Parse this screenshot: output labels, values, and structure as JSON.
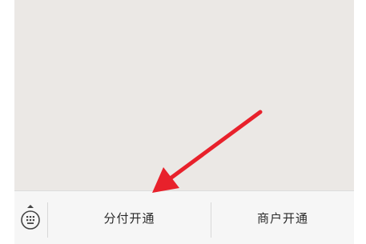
{
  "menu": {
    "keyboard_icon": "keyboard-icon",
    "items": [
      {
        "label": "分付开通"
      },
      {
        "label": "商户开通"
      }
    ]
  },
  "colors": {
    "chat_background": "#ebe8e5",
    "menu_background": "#f6f6f6",
    "annotation_arrow": "#e8212b"
  }
}
